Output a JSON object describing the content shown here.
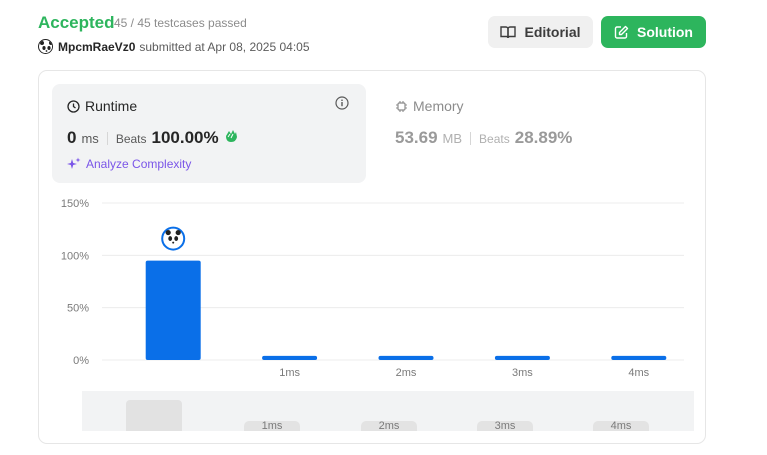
{
  "header": {
    "status": "Accepted",
    "testcases": "45 / 45 testcases passed",
    "username": "MpcmRaeVz0",
    "submitted": "submitted at Apr 08, 2025 04:05",
    "editorial_label": "Editorial",
    "solution_label": "Solution",
    "accent_color": "#2db55d"
  },
  "runtime": {
    "title": "Runtime",
    "value": "0",
    "unit": "ms",
    "beats_label": "Beats",
    "beats_value": "100.00%",
    "analyze_label": "Analyze Complexity"
  },
  "memory": {
    "title": "Memory",
    "value": "53.69",
    "unit": "MB",
    "beats_label": "Beats",
    "beats_value": "28.89%"
  },
  "chart_data": {
    "type": "bar",
    "categories": [
      "0ms",
      "1ms",
      "2ms",
      "3ms",
      "4ms"
    ],
    "x_tick_labels": [
      "",
      "1ms",
      "2ms",
      "3ms",
      "4ms"
    ],
    "values": [
      95,
      4,
      4,
      4,
      4
    ],
    "y_ticks": [
      "150%",
      "100%",
      "50%",
      "0%"
    ],
    "ylim": [
      0,
      150
    ],
    "bar_color": "#0a6fe8",
    "grid": true,
    "highlight_category": "0ms",
    "brush_labels": [
      "1ms",
      "2ms",
      "3ms",
      "4ms"
    ]
  }
}
